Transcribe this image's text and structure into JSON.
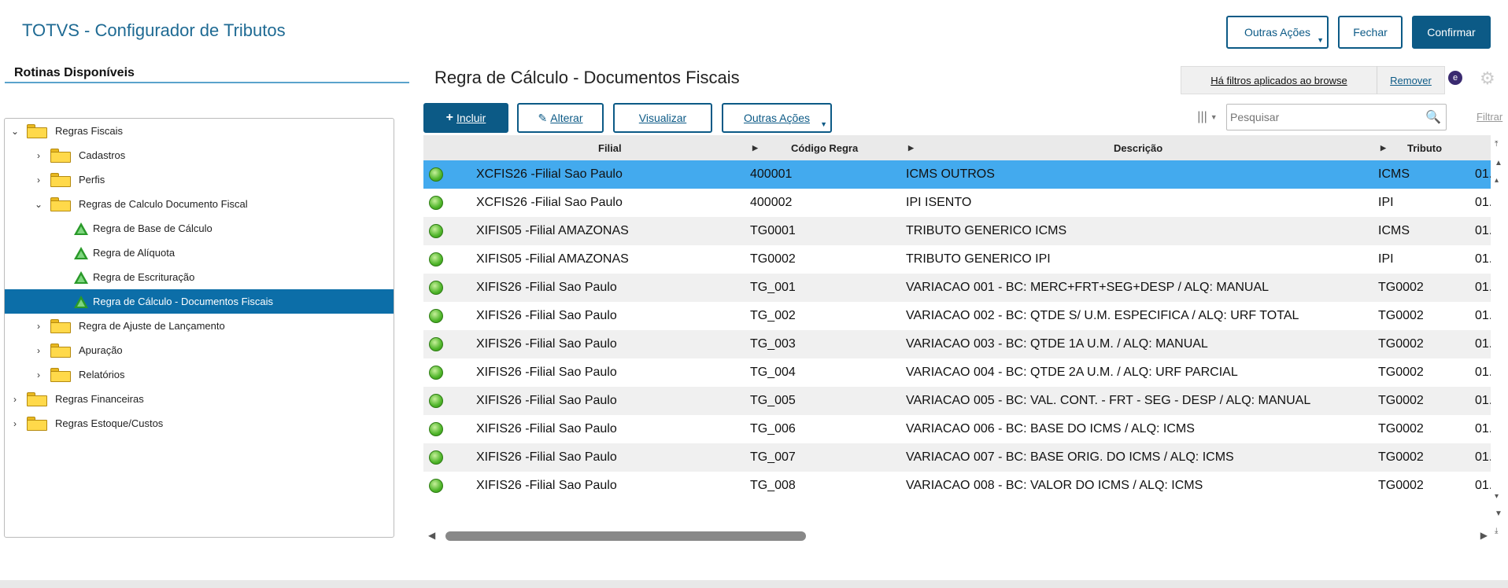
{
  "app": {
    "title": "TOTVS - Configurador de Tributos",
    "buttons": {
      "other_actions": "Outras Ações",
      "close": "Fechar",
      "confirm": "Confirmar"
    }
  },
  "sidebar": {
    "title": "Rotinas Disponíveis",
    "items": [
      {
        "label": "Regras Fiscais"
      },
      {
        "label": "Cadastros"
      },
      {
        "label": "Perfis"
      },
      {
        "label": "Regras de Calculo Documento Fiscal"
      },
      {
        "label": "Regra de Base de Cálculo"
      },
      {
        "label": "Regra de Alíquota"
      },
      {
        "label": "Regra de Escrituração"
      },
      {
        "label": "Regra de Cálculo - Documentos Fiscais"
      },
      {
        "label": "Regra de Ajuste de Lançamento"
      },
      {
        "label": "Apuração"
      },
      {
        "label": "Relatórios"
      },
      {
        "label": "Regras Financeiras"
      },
      {
        "label": "Regras Estoque/Custos"
      }
    ]
  },
  "main": {
    "title": "Regra de Cálculo - Documentos Fiscais",
    "filters_msg": "Há filtros aplicados ao browse",
    "remove": "Remover",
    "toolbar": {
      "include": "Incluir",
      "edit": "Alterar",
      "view": "Visualizar",
      "other": "Outras Ações"
    },
    "search_placeholder": "Pesquisar",
    "filter_link": "Filtrar",
    "columns": {
      "filial": "Filial",
      "codigo": "Código Regra",
      "descricao": "Descrição",
      "tributo": "Tributo"
    },
    "rows": [
      {
        "filial": "XCFIS26 -Filial Sao Paulo",
        "codigo": "400001",
        "descricao": "ICMS OUTROS",
        "tributo": "ICMS",
        "extra": "01."
      },
      {
        "filial": "XCFIS26 -Filial Sao Paulo",
        "codigo": "400002",
        "descricao": "IPI ISENTO",
        "tributo": "IPI",
        "extra": "01."
      },
      {
        "filial": "XIFIS05 -Filial AMAZONAS",
        "codigo": "TG0001",
        "descricao": "TRIBUTO GENERICO ICMS",
        "tributo": "ICMS",
        "extra": "01."
      },
      {
        "filial": "XIFIS05 -Filial AMAZONAS",
        "codigo": "TG0002",
        "descricao": "TRIBUTO GENERICO IPI",
        "tributo": "IPI",
        "extra": "01."
      },
      {
        "filial": "XIFIS26 -Filial Sao Paulo",
        "codigo": "TG_001",
        "descricao": "VARIACAO 001 - BC: MERC+FRT+SEG+DESP / ALQ: MANUAL",
        "tributo": "TG0002",
        "extra": "01."
      },
      {
        "filial": "XIFIS26 -Filial Sao Paulo",
        "codigo": "TG_002",
        "descricao": "VARIACAO 002 - BC: QTDE S/ U.M. ESPECIFICA / ALQ: URF TOTAL",
        "tributo": "TG0002",
        "extra": "01."
      },
      {
        "filial": "XIFIS26 -Filial Sao Paulo",
        "codigo": "TG_003",
        "descricao": "VARIACAO 003 - BC: QTDE 1A U.M. / ALQ: MANUAL",
        "tributo": "TG0002",
        "extra": "01."
      },
      {
        "filial": "XIFIS26 -Filial Sao Paulo",
        "codigo": "TG_004",
        "descricao": "VARIACAO 004 - BC: QTDE 2A U.M. / ALQ: URF PARCIAL",
        "tributo": "TG0002",
        "extra": "01."
      },
      {
        "filial": "XIFIS26 -Filial Sao Paulo",
        "codigo": "TG_005",
        "descricao": "VARIACAO 005 - BC: VAL. CONT. - FRT - SEG - DESP / ALQ: MANUAL",
        "tributo": "TG0002",
        "extra": "01."
      },
      {
        "filial": "XIFIS26 -Filial Sao Paulo",
        "codigo": "TG_006",
        "descricao": "VARIACAO 006 - BC: BASE DO ICMS / ALQ: ICMS",
        "tributo": "TG0002",
        "extra": "01."
      },
      {
        "filial": "XIFIS26 -Filial Sao Paulo",
        "codigo": "TG_007",
        "descricao": "VARIACAO 007 - BC: BASE ORIG. DO ICMS / ALQ: ICMS",
        "tributo": "TG0002",
        "extra": "01."
      },
      {
        "filial": "XIFIS26 -Filial Sao Paulo",
        "codigo": "TG_008",
        "descricao": "VARIACAO 008 - BC: VALOR DO ICMS / ALQ: ICMS",
        "tributo": "TG0002",
        "extra": "01."
      }
    ]
  },
  "colors": {
    "primary": "#0c5a86",
    "selected_row": "#43aaee",
    "selected_tree": "#0c6ea8"
  }
}
